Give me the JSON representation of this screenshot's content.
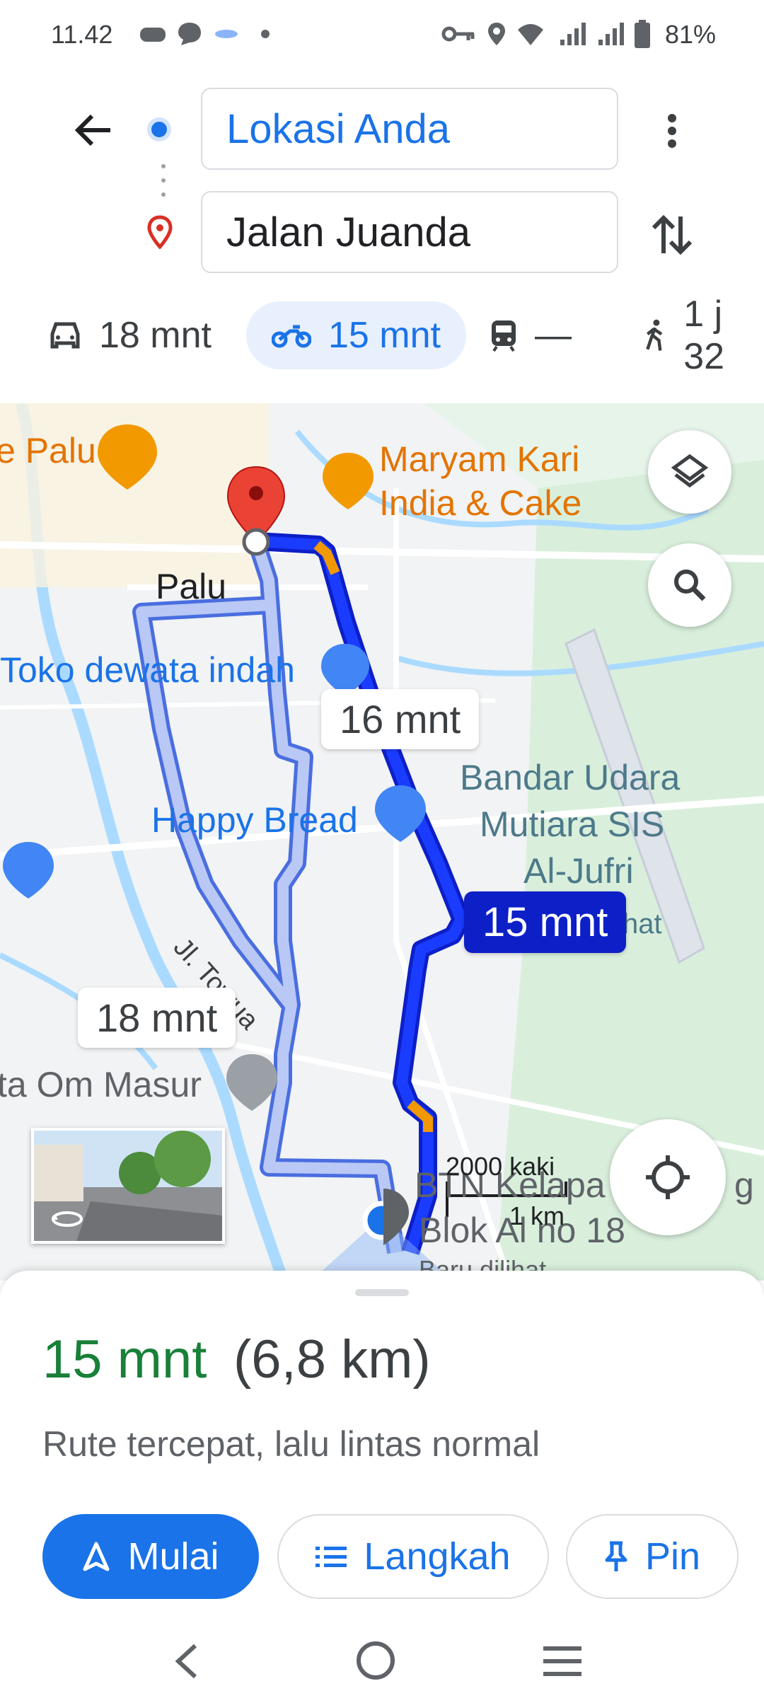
{
  "status_bar": {
    "time": "11.42",
    "battery": "81%"
  },
  "directions": {
    "origin": "Lokasi Anda",
    "destination": "Jalan Juanda"
  },
  "modes": [
    {
      "name": "car",
      "label": "18 mnt"
    },
    {
      "name": "motorcycle",
      "label": "15 mnt"
    },
    {
      "name": "transit",
      "label": "—"
    },
    {
      "name": "walk",
      "label": "1 j 32"
    }
  ],
  "map": {
    "places": {
      "palu_left": "e Palu",
      "maryam_1": "Maryam Kari",
      "maryam_2": "India & Cake",
      "palu": "Palu",
      "toko": "Toko dewata indah",
      "happy_bread": "Happy Bread",
      "airport_1": "Bandar Udara",
      "airport_2": "Mutiara SIS",
      "airport_3": "Al-Jufri",
      "airport_4": "hat",
      "street": "Jl. Towua",
      "om_masur": "ta Om Masur",
      "kelapa": "BTN Kelapa",
      "kelapa_g": "g",
      "blok": "Blok Al no 18",
      "recent": "Baru dilihat"
    },
    "route_labels": {
      "alt1": "16 mnt",
      "selected": "15 mnt",
      "alt2": "18 mnt"
    },
    "scale": {
      "imperial": "2000 kaki",
      "metric": "1 km"
    }
  },
  "summary": {
    "duration": "15 mnt",
    "distance": "(6,8 km)",
    "description": "Rute tercepat, lalu lintas normal"
  },
  "actions": {
    "start": "Mulai",
    "steps": "Langkah",
    "pin": "Pin"
  },
  "colors": {
    "accent": "#1a73e8",
    "route_selected": "#0d1fc7",
    "route_alt": "#9fb4f0",
    "duration_green": "#188038"
  }
}
